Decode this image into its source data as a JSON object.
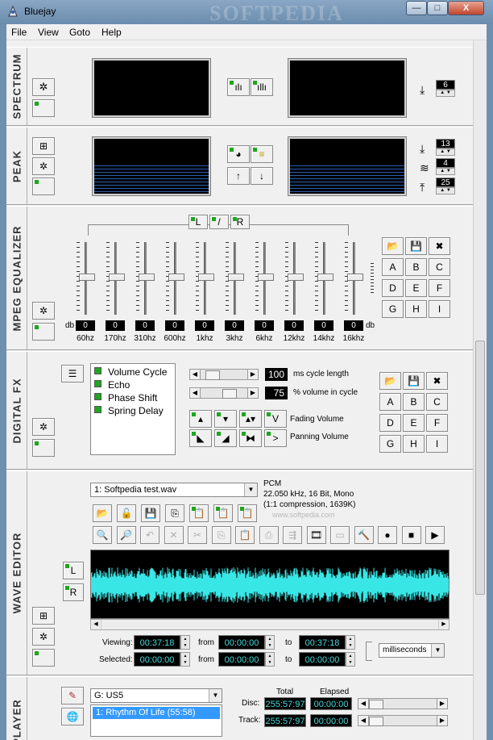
{
  "window": {
    "title": "Bluejay",
    "watermark": "SOFTPEDIA",
    "min": "—",
    "max": "□",
    "close": "X"
  },
  "menu": [
    "File",
    "View",
    "Goto",
    "Help"
  ],
  "spectrum": {
    "label": "SPECTRUM",
    "decay_value": "6"
  },
  "peak": {
    "label": "PEAK",
    "fall_value": "13",
    "hold_value": "4",
    "rise_value": "25"
  },
  "equalizer": {
    "label": "MPEG EQUALIZER",
    "channel_buttons": [
      "L",
      "/",
      "R"
    ],
    "db_label": "db",
    "bands": [
      {
        "freq": "60hz",
        "value": "0"
      },
      {
        "freq": "170hz",
        "value": "0"
      },
      {
        "freq": "310hz",
        "value": "0"
      },
      {
        "freq": "600hz",
        "value": "0"
      },
      {
        "freq": "1khz",
        "value": "0"
      },
      {
        "freq": "3khz",
        "value": "0"
      },
      {
        "freq": "6khz",
        "value": "0"
      },
      {
        "freq": "12khz",
        "value": "0"
      },
      {
        "freq": "14khz",
        "value": "0"
      },
      {
        "freq": "16khz",
        "value": "0"
      }
    ],
    "presets": [
      "A",
      "B",
      "C",
      "D",
      "E",
      "F",
      "G",
      "H",
      "I"
    ]
  },
  "digital_fx": {
    "label": "DIGITAL FX",
    "effects": [
      "Volume Cycle",
      "Echo",
      "Phase Shift",
      "Spring Delay"
    ],
    "cycle_value": "100",
    "cycle_label": "ms cycle length",
    "volume_value": "75",
    "volume_label": "% volume in cycle",
    "fading_label": "Fading Volume",
    "panning_label": "Panning Volume",
    "presets": [
      "A",
      "B",
      "C",
      "D",
      "E",
      "F",
      "G",
      "H",
      "I"
    ]
  },
  "wave_editor": {
    "label": "WAVE EDITOR",
    "file": "1: Softpedia test.wav",
    "format": "PCM",
    "format_detail": "22.050 kHz, 16 Bit, Mono",
    "compression": "(1:1 compression, 1639K)",
    "site": "www.softpedia.com",
    "viewing_label": "Viewing:",
    "selected_label": "Selected:",
    "from_label": "from",
    "to_label": "to",
    "viewing": {
      "length": "00:37:18",
      "from": "00:00:00",
      "to": "00:37:18"
    },
    "selected": {
      "length": "00:00:00",
      "from": "00:00:00",
      "to": "00:00:00"
    },
    "unit": "milliseconds",
    "channel_l": "L",
    "channel_r": "R"
  },
  "player": {
    "label": "PLAYER",
    "drive": "G: US5",
    "tracks": [
      "1: Rhythm Of Life (55:58)"
    ],
    "total_header": "Total",
    "elapsed_header": "Elapsed",
    "disc_label": "Disc:",
    "track_label": "Track:",
    "disc_total": "255:57:97",
    "disc_elapsed": "00:00:00",
    "track_total": "255:57:97",
    "track_elapsed": "00:00:00"
  }
}
